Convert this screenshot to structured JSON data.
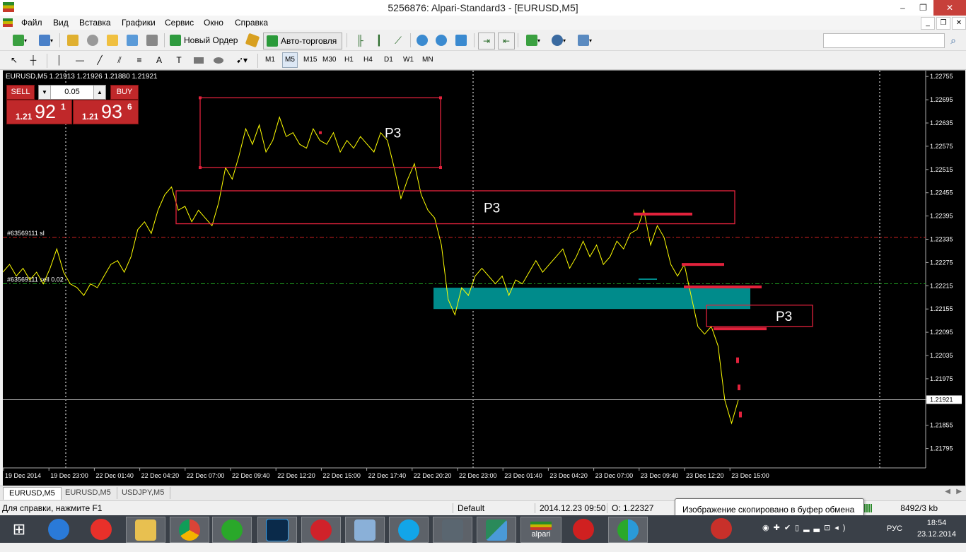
{
  "window": {
    "title": "5256876: Alpari-Standard3 - [EURUSD,M5]",
    "min": "–",
    "max": "❐",
    "close": "✕"
  },
  "menu": [
    "Файл",
    "Вид",
    "Вставка",
    "Графики",
    "Сервис",
    "Окно",
    "Справка"
  ],
  "toolbar": {
    "new_order": "Новый Ордер",
    "auto_trading": "Авто-торговля",
    "search_placeholder": "",
    "search_icon": "⌕"
  },
  "timeframes": [
    "M1",
    "M5",
    "M15",
    "M30",
    "H1",
    "H4",
    "D1",
    "W1",
    "MN"
  ],
  "active_timeframe": "M5",
  "chart_header": "EURUSD,M5  1.21913 1.21926 1.21880 1.21921",
  "one_click": {
    "sell": "SELL",
    "buy": "BUY",
    "lot": "0.05",
    "lot_down": "▼",
    "lot_up": "▲",
    "bid_small": "1.21",
    "bid_big": "92",
    "bid_sup": "1",
    "ask_small": "1.21",
    "ask_big": "93",
    "ask_sup": "6"
  },
  "chart_data": {
    "type": "line",
    "symbol": "EURUSD",
    "timeframe": "M5",
    "ohlc_header": {
      "open": 1.21913,
      "high": 1.21926,
      "low": 1.2188,
      "close": 1.21921
    },
    "ylim": [
      1.21745,
      1.2277
    ],
    "y_ticks": [
      "1.22755",
      "1.22695",
      "1.22635",
      "1.22575",
      "1.22515",
      "1.22455",
      "1.22395",
      "1.22335",
      "1.22275",
      "1.22215",
      "1.22155",
      "1.22095",
      "1.22035",
      "1.21975",
      "1.21921",
      "1.21855",
      "1.21795"
    ],
    "x_ticks": [
      "19 Dec 2014",
      "19 Dec 23:00",
      "22 Dec 01:40",
      "22 Dec 04:20",
      "22 Dec 07:00",
      "22 Dec 09:40",
      "22 Dec 12:20",
      "22 Dec 15:00",
      "22 Dec 17:40",
      "22 Dec 20:20",
      "22 Dec 23:00",
      "23 Dec 01:40",
      "23 Dec 04:20",
      "23 Dec 07:00",
      "23 Dec 09:40",
      "23 Dec 12:20",
      "23 Dec 15:00"
    ],
    "current_price": 1.21921,
    "series_points": [
      [
        0,
        1.2225
      ],
      [
        2,
        1.2227
      ],
      [
        4,
        1.2224
      ],
      [
        6,
        1.2226
      ],
      [
        8,
        1.2223
      ],
      [
        10,
        1.2225
      ],
      [
        12,
        1.2222
      ],
      [
        14,
        1.2226
      ],
      [
        16,
        1.2231
      ],
      [
        18,
        1.2225
      ],
      [
        20,
        1.2222
      ],
      [
        22,
        1.2221
      ],
      [
        24,
        1.2219
      ],
      [
        26,
        1.2222
      ],
      [
        28,
        1.2221
      ],
      [
        30,
        1.2224
      ],
      [
        32,
        1.2227
      ],
      [
        34,
        1.2228
      ],
      [
        36,
        1.2225
      ],
      [
        38,
        1.2229
      ],
      [
        40,
        1.2236
      ],
      [
        42,
        1.2238
      ],
      [
        44,
        1.2235
      ],
      [
        46,
        1.2241
      ],
      [
        48,
        1.2245
      ],
      [
        50,
        1.2247
      ],
      [
        52,
        1.2241
      ],
      [
        54,
        1.2242
      ],
      [
        56,
        1.2238
      ],
      [
        58,
        1.2241
      ],
      [
        60,
        1.2239
      ],
      [
        62,
        1.2237
      ],
      [
        64,
        1.2243
      ],
      [
        66,
        1.2252
      ],
      [
        68,
        1.2249
      ],
      [
        70,
        1.2255
      ],
      [
        72,
        1.2262
      ],
      [
        74,
        1.2258
      ],
      [
        76,
        1.2263
      ],
      [
        78,
        1.2256
      ],
      [
        80,
        1.2259
      ],
      [
        82,
        1.2265
      ],
      [
        84,
        1.226
      ],
      [
        86,
        1.2261
      ],
      [
        88,
        1.2258
      ],
      [
        90,
        1.2257
      ],
      [
        92,
        1.2262
      ],
      [
        94,
        1.2259
      ],
      [
        96,
        1.2258
      ],
      [
        98,
        1.2261
      ],
      [
        100,
        1.2256
      ],
      [
        102,
        1.2259
      ],
      [
        104,
        1.2257
      ],
      [
        106,
        1.226
      ],
      [
        108,
        1.2258
      ],
      [
        110,
        1.2256
      ],
      [
        112,
        1.2261
      ],
      [
        114,
        1.2259
      ],
      [
        116,
        1.2252
      ],
      [
        118,
        1.2244
      ],
      [
        120,
        1.2249
      ],
      [
        122,
        1.2253
      ],
      [
        124,
        1.2245
      ],
      [
        126,
        1.2241
      ],
      [
        128,
        1.2239
      ],
      [
        130,
        1.2232
      ],
      [
        132,
        1.2218
      ],
      [
        134,
        1.2214
      ],
      [
        136,
        1.2221
      ],
      [
        138,
        1.2219
      ],
      [
        140,
        1.2224
      ],
      [
        142,
        1.2226
      ],
      [
        144,
        1.2224
      ],
      [
        146,
        1.2222
      ],
      [
        148,
        1.2224
      ],
      [
        150,
        1.2219
      ],
      [
        152,
        1.2223
      ],
      [
        154,
        1.2222
      ],
      [
        156,
        1.2225
      ],
      [
        158,
        1.2228
      ],
      [
        160,
        1.2225
      ],
      [
        162,
        1.2227
      ],
      [
        164,
        1.2229
      ],
      [
        166,
        1.2231
      ],
      [
        168,
        1.2226
      ],
      [
        170,
        1.2229
      ],
      [
        172,
        1.2233
      ],
      [
        174,
        1.2229
      ],
      [
        176,
        1.2232
      ],
      [
        178,
        1.2227
      ],
      [
        180,
        1.2229
      ],
      [
        182,
        1.2233
      ],
      [
        184,
        1.2231
      ],
      [
        186,
        1.2235
      ],
      [
        188,
        1.2236
      ],
      [
        190,
        1.2241
      ],
      [
        192,
        1.2232
      ],
      [
        194,
        1.2237
      ],
      [
        196,
        1.2234
      ],
      [
        198,
        1.2227
      ],
      [
        200,
        1.2224
      ],
      [
        202,
        1.2227
      ],
      [
        204,
        1.2219
      ],
      [
        206,
        1.2211
      ],
      [
        208,
        1.2209
      ],
      [
        210,
        1.2211
      ],
      [
        212,
        1.2206
      ],
      [
        214,
        1.2192
      ],
      [
        216,
        1.2186
      ],
      [
        218,
        1.2192
      ]
    ]
  },
  "annotations": {
    "box1_label": "P3",
    "box2_label": "P3",
    "box3_label": "P3",
    "sl_line_label": "#63569111 sl",
    "order_line_label": "#63569111 sell 0.02",
    "sl_price": 1.2234,
    "order_price": 1.2222,
    "zone_top": 1.2221,
    "zone_bottom": 1.22155
  },
  "colors": {
    "background": "#000000",
    "price_line": "#ffff00",
    "box": "#e2223c",
    "zone": "#008b8b",
    "sl_line": "#d02020",
    "order_line": "#20a020",
    "grid": "#ffffff"
  },
  "chart_tabs": [
    "EURUSD,M5",
    "EURUSD,M5",
    "USDJPY,M5"
  ],
  "status": {
    "help": "Для справки, нажмите F1",
    "profile": "Default",
    "datetime": "2014.12.23 09:50",
    "open": "O: 1.22327",
    "traffic": "8492/3 kb"
  },
  "tooltip": "Изображение скопировано в буфер обмена",
  "taskbar": {
    "apps": [
      "windows",
      "ie",
      "yandex",
      "explorer",
      "chrome",
      "mailru",
      "photoshop",
      "opera",
      "keyboard",
      "skype",
      "cs",
      "app",
      "alpari",
      "app2",
      "idm"
    ],
    "alpari_label": "alpari",
    "lang": "РУС",
    "time": "18:54",
    "date": "23.12.2014"
  }
}
